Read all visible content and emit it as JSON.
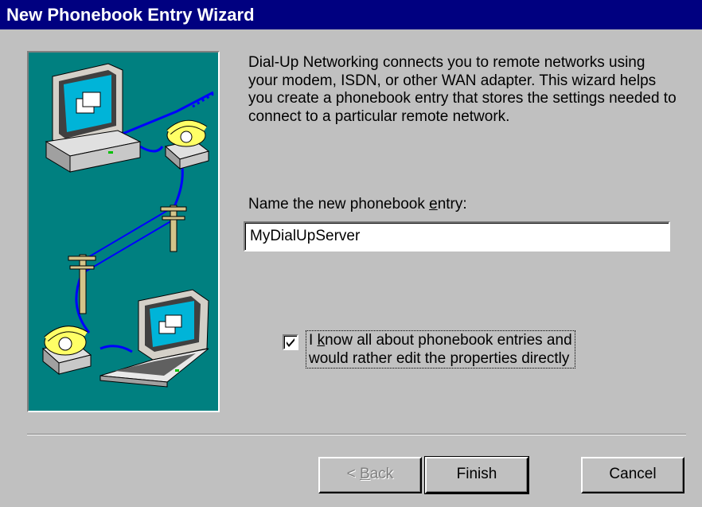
{
  "window": {
    "title": "New Phonebook Entry Wizard"
  },
  "intro_text": "Dial-Up Networking connects you to remote networks using your modem, ISDN, or other WAN adapter.  This wizard helps you create a phonebook entry that stores the settings needed to connect to a particular remote network.",
  "name_field": {
    "label": "Name the new phonebook entry:",
    "value": "MyDialUpServer"
  },
  "edit_directly": {
    "checked": true,
    "line1": "I know all about phonebook entries and",
    "line2": "would rather edit the properties directly"
  },
  "buttons": {
    "back": "< Back",
    "finish": "Finish",
    "cancel": "Cancel"
  },
  "colors": {
    "titlebar": "#000080",
    "art_background": "#008080",
    "dialog_face": "#c0c0c0",
    "wire": "#0000ff"
  }
}
